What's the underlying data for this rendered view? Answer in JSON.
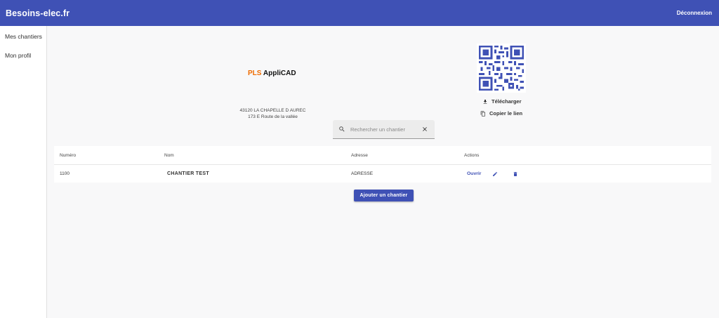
{
  "app": {
    "brand": "Besoins-elec.fr",
    "logout_label": "Déconnexion"
  },
  "sidebar": {
    "items": [
      {
        "label": "Mes chantiers"
      },
      {
        "label": "Mon profil"
      }
    ]
  },
  "company": {
    "name_prefix": "PLS",
    "name_suffix": "AppliCAD",
    "address_line1": "43120 LA CHAPELLE D AUREC",
    "address_line2": "173 E Route de la vallée"
  },
  "qr": {
    "download_label": "Télécharger",
    "copy_label": "Copier le lien",
    "download_icon": "download-icon",
    "copy_icon": "copy-icon"
  },
  "search": {
    "placeholder": "Rechercher un chantier",
    "value": ""
  },
  "table": {
    "headers": [
      "Numéro",
      "Nom",
      "Adresse",
      "Actions"
    ],
    "rows": [
      {
        "number": "1100",
        "name": "CHANTIER TEST",
        "address": "ADRESSE",
        "open_label": "Ouvrir"
      }
    ]
  },
  "add_button_label": "Ajouter un chantier",
  "colors": {
    "primary": "#3f51b5",
    "accent": "#ef6c00",
    "background": "#f8f8f9"
  }
}
